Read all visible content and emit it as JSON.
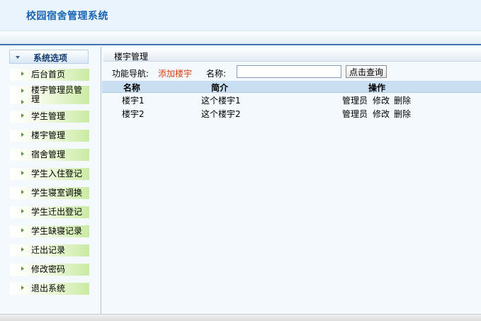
{
  "header": {
    "title": "校园宿舍管理系统"
  },
  "sidebar": {
    "heading": "系统选项",
    "items": [
      {
        "label": "后台首页"
      },
      {
        "label": "楼宇管理员管理"
      },
      {
        "label": "学生管理"
      },
      {
        "label": "楼宇管理"
      },
      {
        "label": "宿舍管理"
      },
      {
        "label": "学生入住登记"
      },
      {
        "label": "学生寝室调换"
      },
      {
        "label": "学生迁出登记"
      },
      {
        "label": "学生缺寝记录"
      },
      {
        "label": "迁出记录"
      },
      {
        "label": "修改密码"
      },
      {
        "label": "退出系统"
      }
    ]
  },
  "main": {
    "title": "楼宇管理",
    "nav_label": "功能导航:",
    "add_link": "添加楼宇",
    "name_label": "名称:",
    "search_value": "",
    "search_button": "点击查询",
    "table": {
      "headers": [
        "名称",
        "简介",
        "操作"
      ],
      "rows": [
        {
          "name": "楼宇1",
          "desc": "这个楼宇1",
          "ops": [
            "管理员",
            "修改",
            "删除"
          ]
        },
        {
          "name": "楼宇2",
          "desc": "这个楼宇2",
          "ops": [
            "管理员",
            "修改",
            "删除"
          ]
        }
      ]
    }
  }
}
